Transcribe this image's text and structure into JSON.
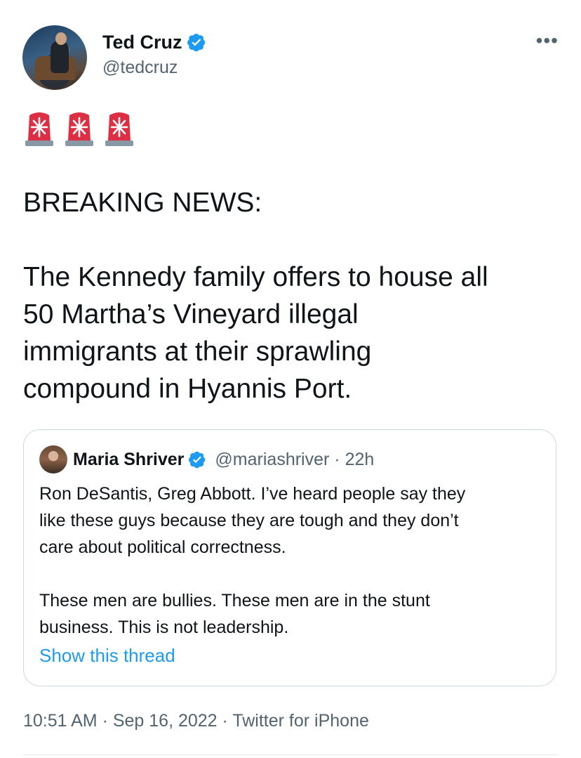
{
  "author": {
    "name": "Ted Cruz",
    "handle": "@tedcruz",
    "verified_icon": "verified-badge-icon"
  },
  "menu": {
    "more_label": "•••"
  },
  "tweet": {
    "emojis": [
      "police-light-icon",
      "police-light-icon",
      "police-light-icon"
    ],
    "text": "BREAKING NEWS:\n\nThe Kennedy family offers to house all\n50 Martha’s Vineyard illegal\nimmigrants at their sprawling\ncompound in Hyannis Port."
  },
  "quoted_tweet": {
    "name": "Maria Shriver",
    "handle": "@mariashriver",
    "separator": "·",
    "time": "22h",
    "text": "Ron DeSantis, Greg Abbott. I’ve heard people say they\nlike these guys because they are tough and they don’t\ncare about political correctness.\n\nThese men are bullies. These men are in the stunt\nbusiness. This is not leadership.",
    "show_thread": "Show this thread"
  },
  "meta": {
    "timestamp": "10:51 AM · Sep 16, 2022 · Twitter for iPhone"
  },
  "colors": {
    "text": "#0f1419",
    "secondary": "#536471",
    "link": "#1d9bf0",
    "verified": "#1d9bf0",
    "border": "#cfd9de"
  }
}
